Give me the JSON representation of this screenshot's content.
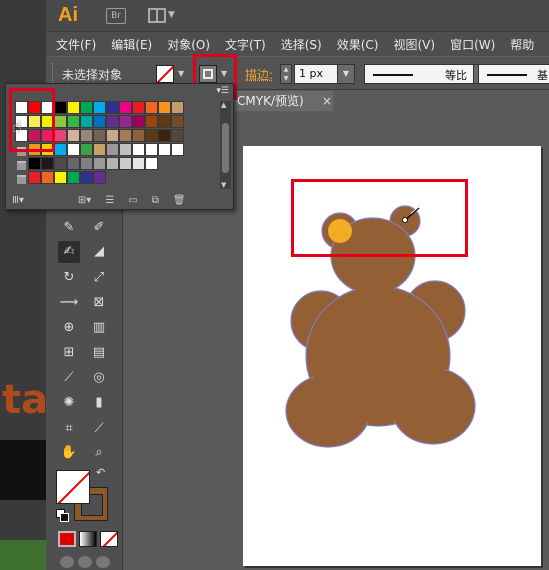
{
  "app": {
    "logo": "Ai",
    "bridge_label": "Br"
  },
  "menu": {
    "items": [
      {
        "label": "文件(F)"
      },
      {
        "label": "编辑(E)"
      },
      {
        "label": "对象(O)"
      },
      {
        "label": "文字(T)"
      },
      {
        "label": "选择(S)"
      },
      {
        "label": "效果(C)"
      },
      {
        "label": "视图(V)"
      },
      {
        "label": "窗口(W)"
      },
      {
        "label": "帮助"
      }
    ]
  },
  "control": {
    "selection_label": "未选择对象",
    "stroke_label": "描边:",
    "stroke_weight": "1 px",
    "profile_label": "等比",
    "brush_label": "基"
  },
  "document": {
    "tab_label": "CMYK/预览)",
    "close_glyph": "×"
  },
  "colors": {
    "accent_red": "#e4001b",
    "bear_brown": "#955f36",
    "bear_outline": "#7d7ec5",
    "ear_highlight": "#f2ad23",
    "stroke_color": "#8b5a2b"
  },
  "swatches": {
    "rows": [
      [
        "#ffffff",
        "#ff0000",
        "#ffffff",
        "#000000",
        "#fff200",
        "#00a651",
        "#00aeef",
        "#2e3192",
        "#ec008c",
        "#ed1c24",
        "#f26522",
        "#f7941d",
        "#c69c6d"
      ],
      [
        "#ffffff",
        "#f7ee55",
        "#eeee00",
        "#8dc63f",
        "#39b54a",
        "#00a99d",
        "#0072bc",
        "#662d91",
        "#92278f",
        "#9e005d",
        "#a0410d",
        "#603913",
        "#754c24"
      ],
      [
        "#ffffff",
        "#c2185b",
        "#e91e63",
        "#ec407a",
        "#cfb59b",
        "#998675",
        "#736357",
        "#c7a98b",
        "#a67c52",
        "#8c6239",
        "#603913",
        "#42210b",
        "#534741"
      ],
      [
        "folder",
        "#f7941d",
        "#ffcc00",
        "#00aeef",
        "#ffffff",
        "#3ea14a",
        "#c7a06a",
        "#999999",
        "#c0c0c0",
        "#ffffff",
        "#ffffff",
        "#ffffff",
        "#ffffff"
      ],
      [
        "folder",
        "#000000",
        "#1a1a1a",
        "#4d4d4d",
        "#666666",
        "#808080",
        "#999999",
        "#b3b3b3",
        "#cccccc",
        "#e6e6e6",
        "#ffffff",
        "",
        ""
      ],
      [
        "folder",
        "#ed1c24",
        "#f26522",
        "#fff200",
        "#00a651",
        "#2e3192",
        "#662d91",
        "",
        "",
        "",
        "",
        "",
        ""
      ]
    ]
  },
  "icons": {
    "tools": [
      "paintbrush-icon",
      "pencil-icon",
      "blob-brush-icon",
      "eraser-icon",
      "rotate-icon",
      "scale-icon",
      "width-icon",
      "free-transform-icon",
      "shape-builder-icon",
      "perspective-icon",
      "mesh-icon",
      "gradient-icon",
      "eyedropper-icon",
      "blend-icon",
      "symbol-sprayer-icon",
      "graph-icon",
      "artboard-icon",
      "slice-icon",
      "hand-icon",
      "zoom-icon"
    ]
  }
}
